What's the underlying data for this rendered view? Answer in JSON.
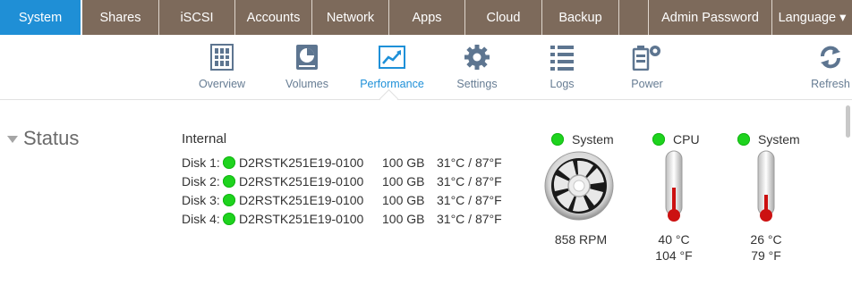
{
  "tabs": [
    {
      "label": "System",
      "active": true
    },
    {
      "label": "Shares"
    },
    {
      "label": "iSCSI"
    },
    {
      "label": "Accounts"
    },
    {
      "label": "Network"
    },
    {
      "label": "Apps"
    },
    {
      "label": "Cloud"
    },
    {
      "label": "Backup"
    },
    {
      "label": ""
    },
    {
      "label": "Admin Password"
    },
    {
      "label": "Language ▾"
    }
  ],
  "toolbar": {
    "items": [
      {
        "label": "Overview",
        "icon": "overview-icon"
      },
      {
        "label": "Volumes",
        "icon": "volumes-icon"
      },
      {
        "label": "Performance",
        "icon": "performance-icon",
        "active": true
      },
      {
        "label": "Settings",
        "icon": "gear-icon"
      },
      {
        "label": "Logs",
        "icon": "list-icon"
      },
      {
        "label": "Power",
        "icon": "power-icon"
      },
      {
        "label": "Refresh",
        "icon": "refresh-icon"
      }
    ]
  },
  "status": {
    "heading": "Status",
    "internal_title": "Internal",
    "disks": [
      {
        "label": "Disk 1:",
        "model": "D2RSTK251E19-0100",
        "size": "100 GB",
        "temp": "31°C / 87°F"
      },
      {
        "label": "Disk 2:",
        "model": "D2RSTK251E19-0100",
        "size": "100 GB",
        "temp": "31°C / 87°F"
      },
      {
        "label": "Disk 3:",
        "model": "D2RSTK251E19-0100",
        "size": "100 GB",
        "temp": "31°C / 87°F"
      },
      {
        "label": "Disk 4:",
        "model": "D2RSTK251E19-0100",
        "size": "100 GB",
        "temp": "31°C / 87°F"
      }
    ],
    "fan": {
      "name": "System",
      "rpm": "858 RPM"
    },
    "cpu": {
      "name": "CPU",
      "celsius": "40 °C",
      "fahrenheit": "104 °F"
    },
    "system_temp": {
      "name": "System",
      "celsius": "26 °C",
      "fahrenheit": "79 °F"
    }
  },
  "colors": {
    "tabbar": "#7d6a5b",
    "active_tab": "#1f8fd6",
    "status_ok": "#1ed31e",
    "toolbar_label": "#667c93",
    "thermometer_red": "#cc1111"
  }
}
